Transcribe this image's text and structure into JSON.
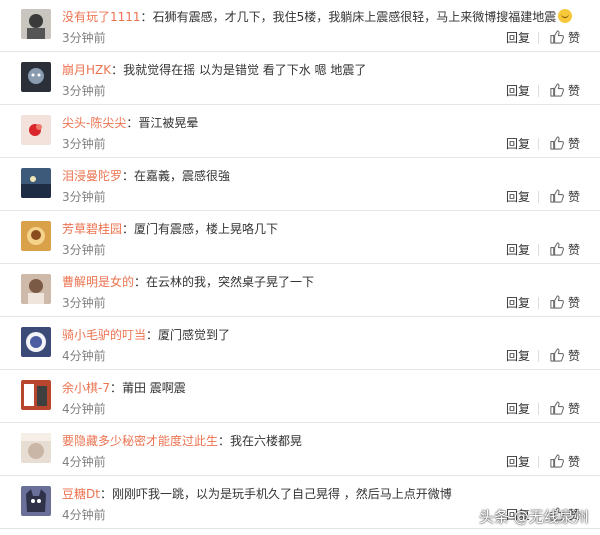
{
  "comments": [
    {
      "username": "没有玩了1111",
      "text": "石狮有震感，才几下，我住5楼，我躺床上震感很轻，马上来微博搜福建地震",
      "emoji": "laughing-emoji",
      "time": "3分钟前",
      "reply": "回复",
      "like": "赞",
      "avatar_color": "#c9c6c0"
    },
    {
      "username": "崩月HZK",
      "text": "我就觉得在摇 以为是错觉 看了下水 嗯 地震了",
      "time": "3分钟前",
      "reply": "回复",
      "like": "赞",
      "avatar_color": "#2b2f38"
    },
    {
      "username": "尖头-陈尖尖",
      "text": "晋江被晃晕",
      "time": "3分钟前",
      "reply": "回复",
      "like": "赞",
      "avatar_color": "#f3e2dc"
    },
    {
      "username": "泪浸曼陀罗",
      "text": "在嘉義，震感很強",
      "time": "3分钟前",
      "reply": "回复",
      "like": "赞",
      "avatar_color": "#3d5a7a"
    },
    {
      "username": "芳草碧桂园",
      "text": "厦门有震感，楼上晃咯几下",
      "time": "3分钟前",
      "reply": "回复",
      "like": "赞",
      "avatar_color": "#d9a24a"
    },
    {
      "username": "曹解明是女的",
      "text": "在云林的我，突然桌子晃了一下",
      "time": "3分钟前",
      "reply": "回复",
      "like": "赞",
      "avatar_color": "#cfb9a8"
    },
    {
      "username": "骑小毛驴的叮当",
      "text": "厦门感觉到了",
      "time": "4分钟前",
      "reply": "回复",
      "like": "赞",
      "avatar_color": "#3c4a78"
    },
    {
      "username": "余小棋-7",
      "text": "莆田 震啊震",
      "time": "4分钟前",
      "reply": "回复",
      "like": "赞",
      "avatar_color": "#b8462e"
    },
    {
      "username": "要隐藏多少秘密才能度过此生",
      "text": "我在六楼都晃",
      "time": "4分钟前",
      "reply": "回复",
      "like": "赞",
      "avatar_color": "#e8ddd3"
    },
    {
      "username": "豆糖Dt",
      "text": "刚刚吓我一跳，以为是玩手机久了自己晃得 ，然后马上点开微博",
      "time": "4分钟前",
      "reply": "回复",
      "like": "赞",
      "avatar_color": "#6a6f9a"
    }
  ],
  "separator": "：",
  "watermark": "头条 @无线泉州",
  "colors": {
    "username": "#eb7350",
    "text": "#333333",
    "meta": "#808080"
  }
}
